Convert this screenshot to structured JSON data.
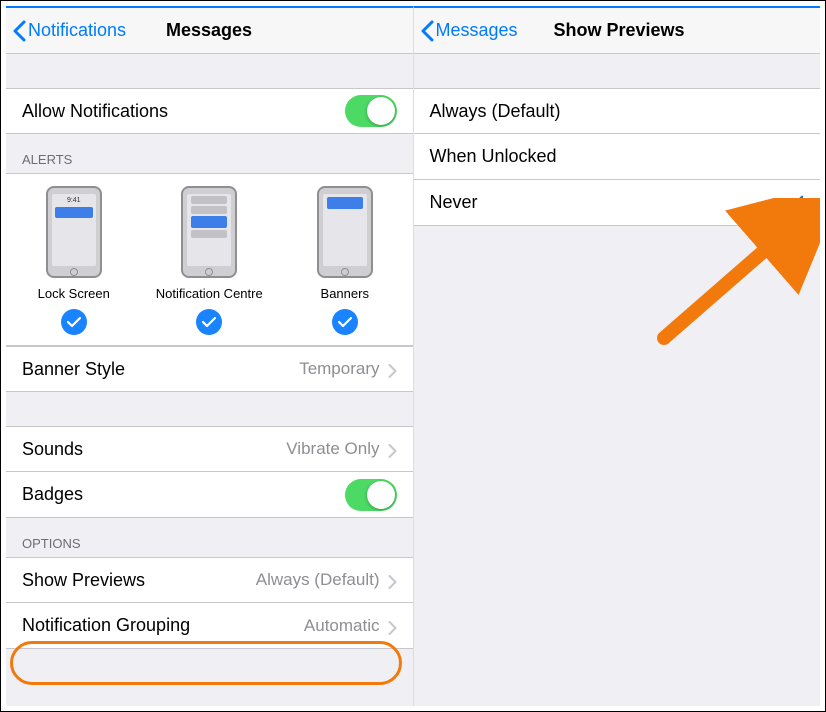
{
  "colors": {
    "accent": "#007aff",
    "switch_on": "#4cd964",
    "highlight": "#f27a0d"
  },
  "left": {
    "nav": {
      "back": "Notifications",
      "title": "Messages"
    },
    "allow": {
      "label": "Allow Notifications",
      "on": true
    },
    "alerts_header": "ALERTS",
    "alert_types": [
      {
        "label": "Lock Screen",
        "selected": true
      },
      {
        "label": "Notification Centre",
        "selected": true
      },
      {
        "label": "Banners",
        "selected": true
      }
    ],
    "phone_time": "9:41",
    "banner_style": {
      "label": "Banner Style",
      "value": "Temporary"
    },
    "sounds": {
      "label": "Sounds",
      "value": "Vibrate Only"
    },
    "badges": {
      "label": "Badges",
      "on": true
    },
    "options_header": "OPTIONS",
    "show_previews": {
      "label": "Show Previews",
      "value": "Always (Default)"
    },
    "notification_grouping": {
      "label": "Notification Grouping",
      "value": "Automatic"
    }
  },
  "right": {
    "nav": {
      "back": "Messages",
      "title": "Show Previews"
    },
    "options": [
      {
        "label": "Always (Default)",
        "selected": false
      },
      {
        "label": "When Unlocked",
        "selected": false
      },
      {
        "label": "Never",
        "selected": true
      }
    ]
  }
}
